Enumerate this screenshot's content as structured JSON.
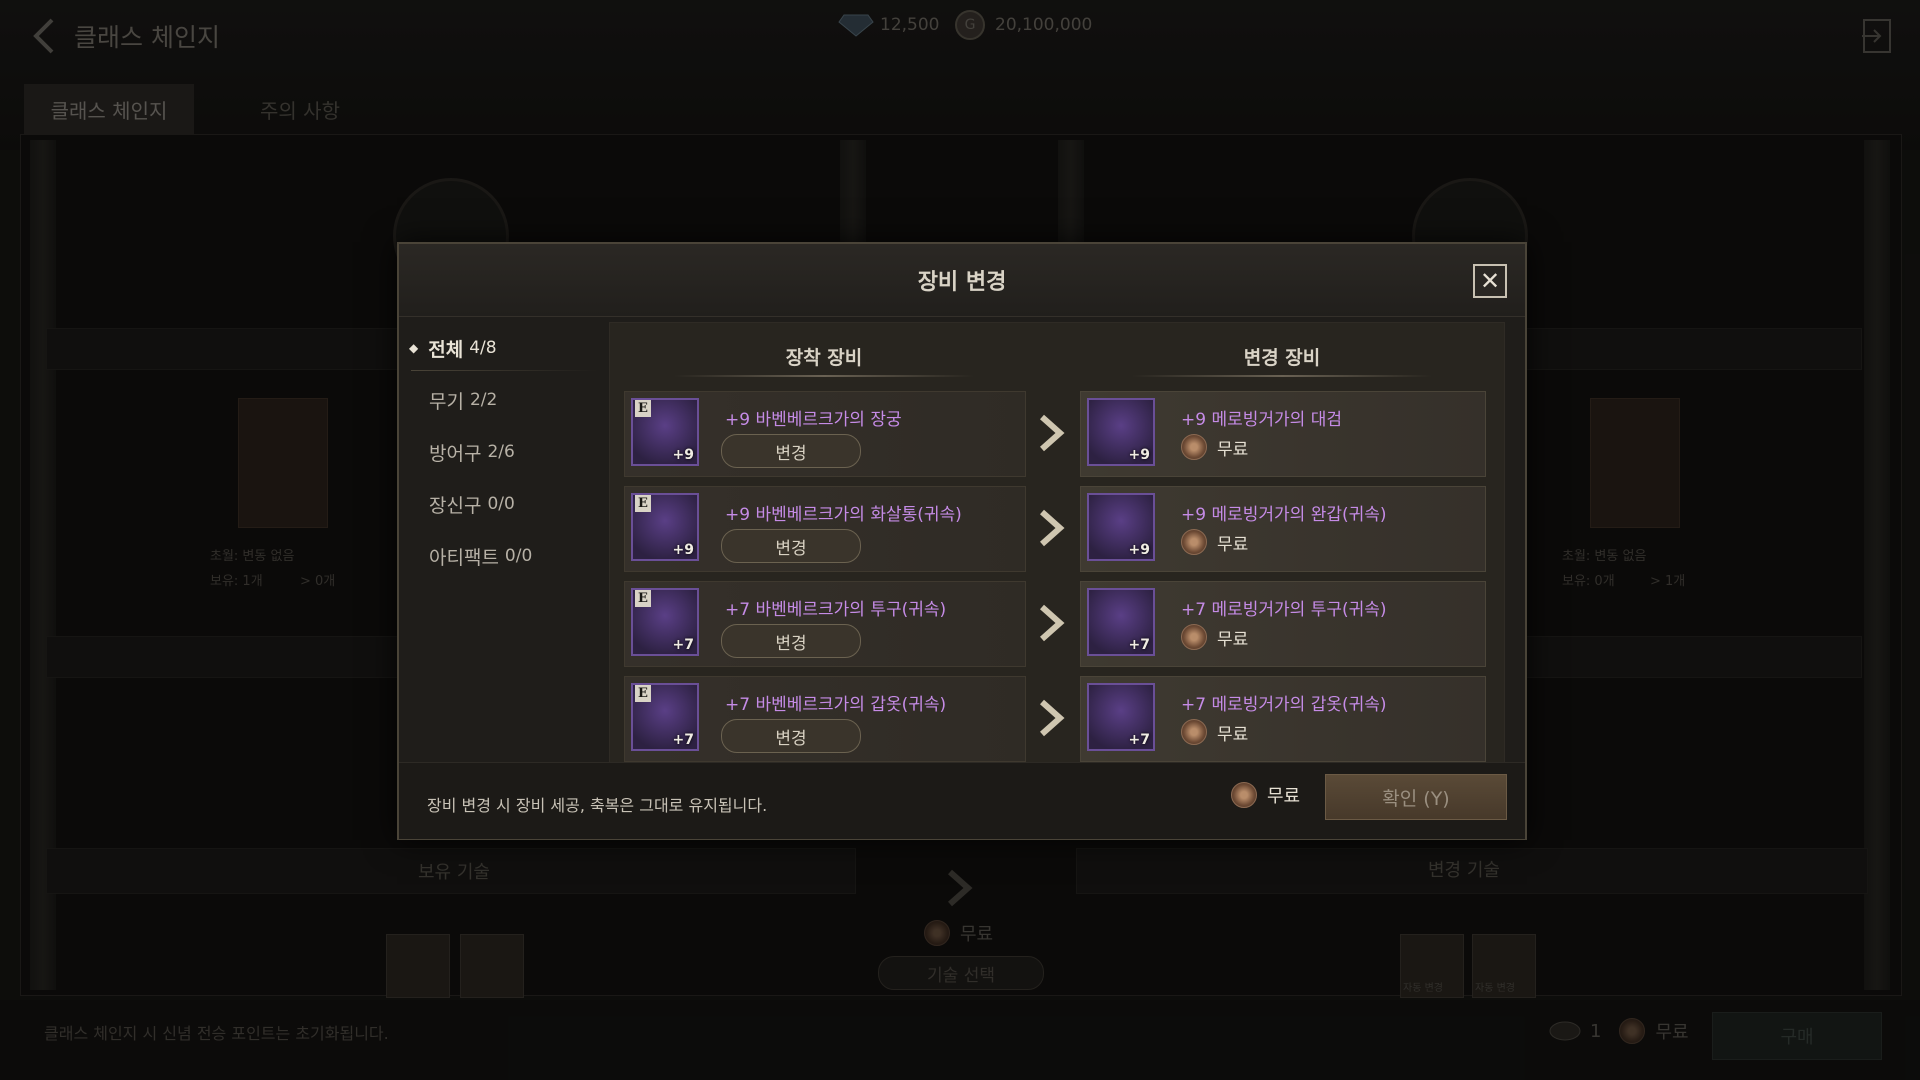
{
  "page": {
    "title": "클래스 체인지",
    "currency": {
      "diamond": "12,500",
      "gold": "20,100,000"
    },
    "tabs": [
      "클래스 체인지",
      "주의 사항"
    ],
    "left_panel": {
      "item_info": "초월: 변동 없음",
      "owned": "보유: 1개",
      "after": "0개"
    },
    "right_panel": {
      "item_info": "초월: 변동 없음",
      "owned": "보유: 0개",
      "after": "1개"
    },
    "owned_skills_label": "보유 기술",
    "change_skills_label": "변경 기술",
    "center_cost": "무료",
    "skill_select_label": "기술 선택",
    "skill_tag": "자동 변경",
    "bottom_note": "클래스 체인지 시 신념 전승 포인트는 초기화됩니다.",
    "bottom_count": "1",
    "bottom_cost": "무료",
    "buy_label": "구매"
  },
  "modal": {
    "title": "장비 변경",
    "categories": [
      {
        "label": "전체",
        "count": "4/8"
      },
      {
        "label": "무기",
        "count": "2/2"
      },
      {
        "label": "방어구",
        "count": "2/6"
      },
      {
        "label": "장신구",
        "count": "0/0"
      },
      {
        "label": "아티팩트",
        "count": "0/0"
      }
    ],
    "equipped_header": "장착 장비",
    "changed_header": "변경 장비",
    "change_button": "변경",
    "free_label": "무료",
    "rows": [
      {
        "equipped": "+9 바벤베르크가의 장궁",
        "changed": "+9 메로빙거가의 대검",
        "level": "+9"
      },
      {
        "equipped": "+9 바벤베르크가의 화살통(귀속)",
        "changed": "+9 메로빙거가의 완갑(귀속)",
        "level": "+9"
      },
      {
        "equipped": "+7 바벤베르크가의 투구(귀속)",
        "changed": "+7 메로빙거가의 투구(귀속)",
        "level": "+7"
      },
      {
        "equipped": "+7 바벤베르크가의 갑옷(귀속)",
        "changed": "+7 메로빙거가의 갑옷(귀속)",
        "level": "+7"
      }
    ],
    "footer_note": "장비 변경 시 장비 세공, 축복은 그대로 유지됩니다.",
    "footer_cost": "무료",
    "confirm_label": "확인 (Y)"
  }
}
